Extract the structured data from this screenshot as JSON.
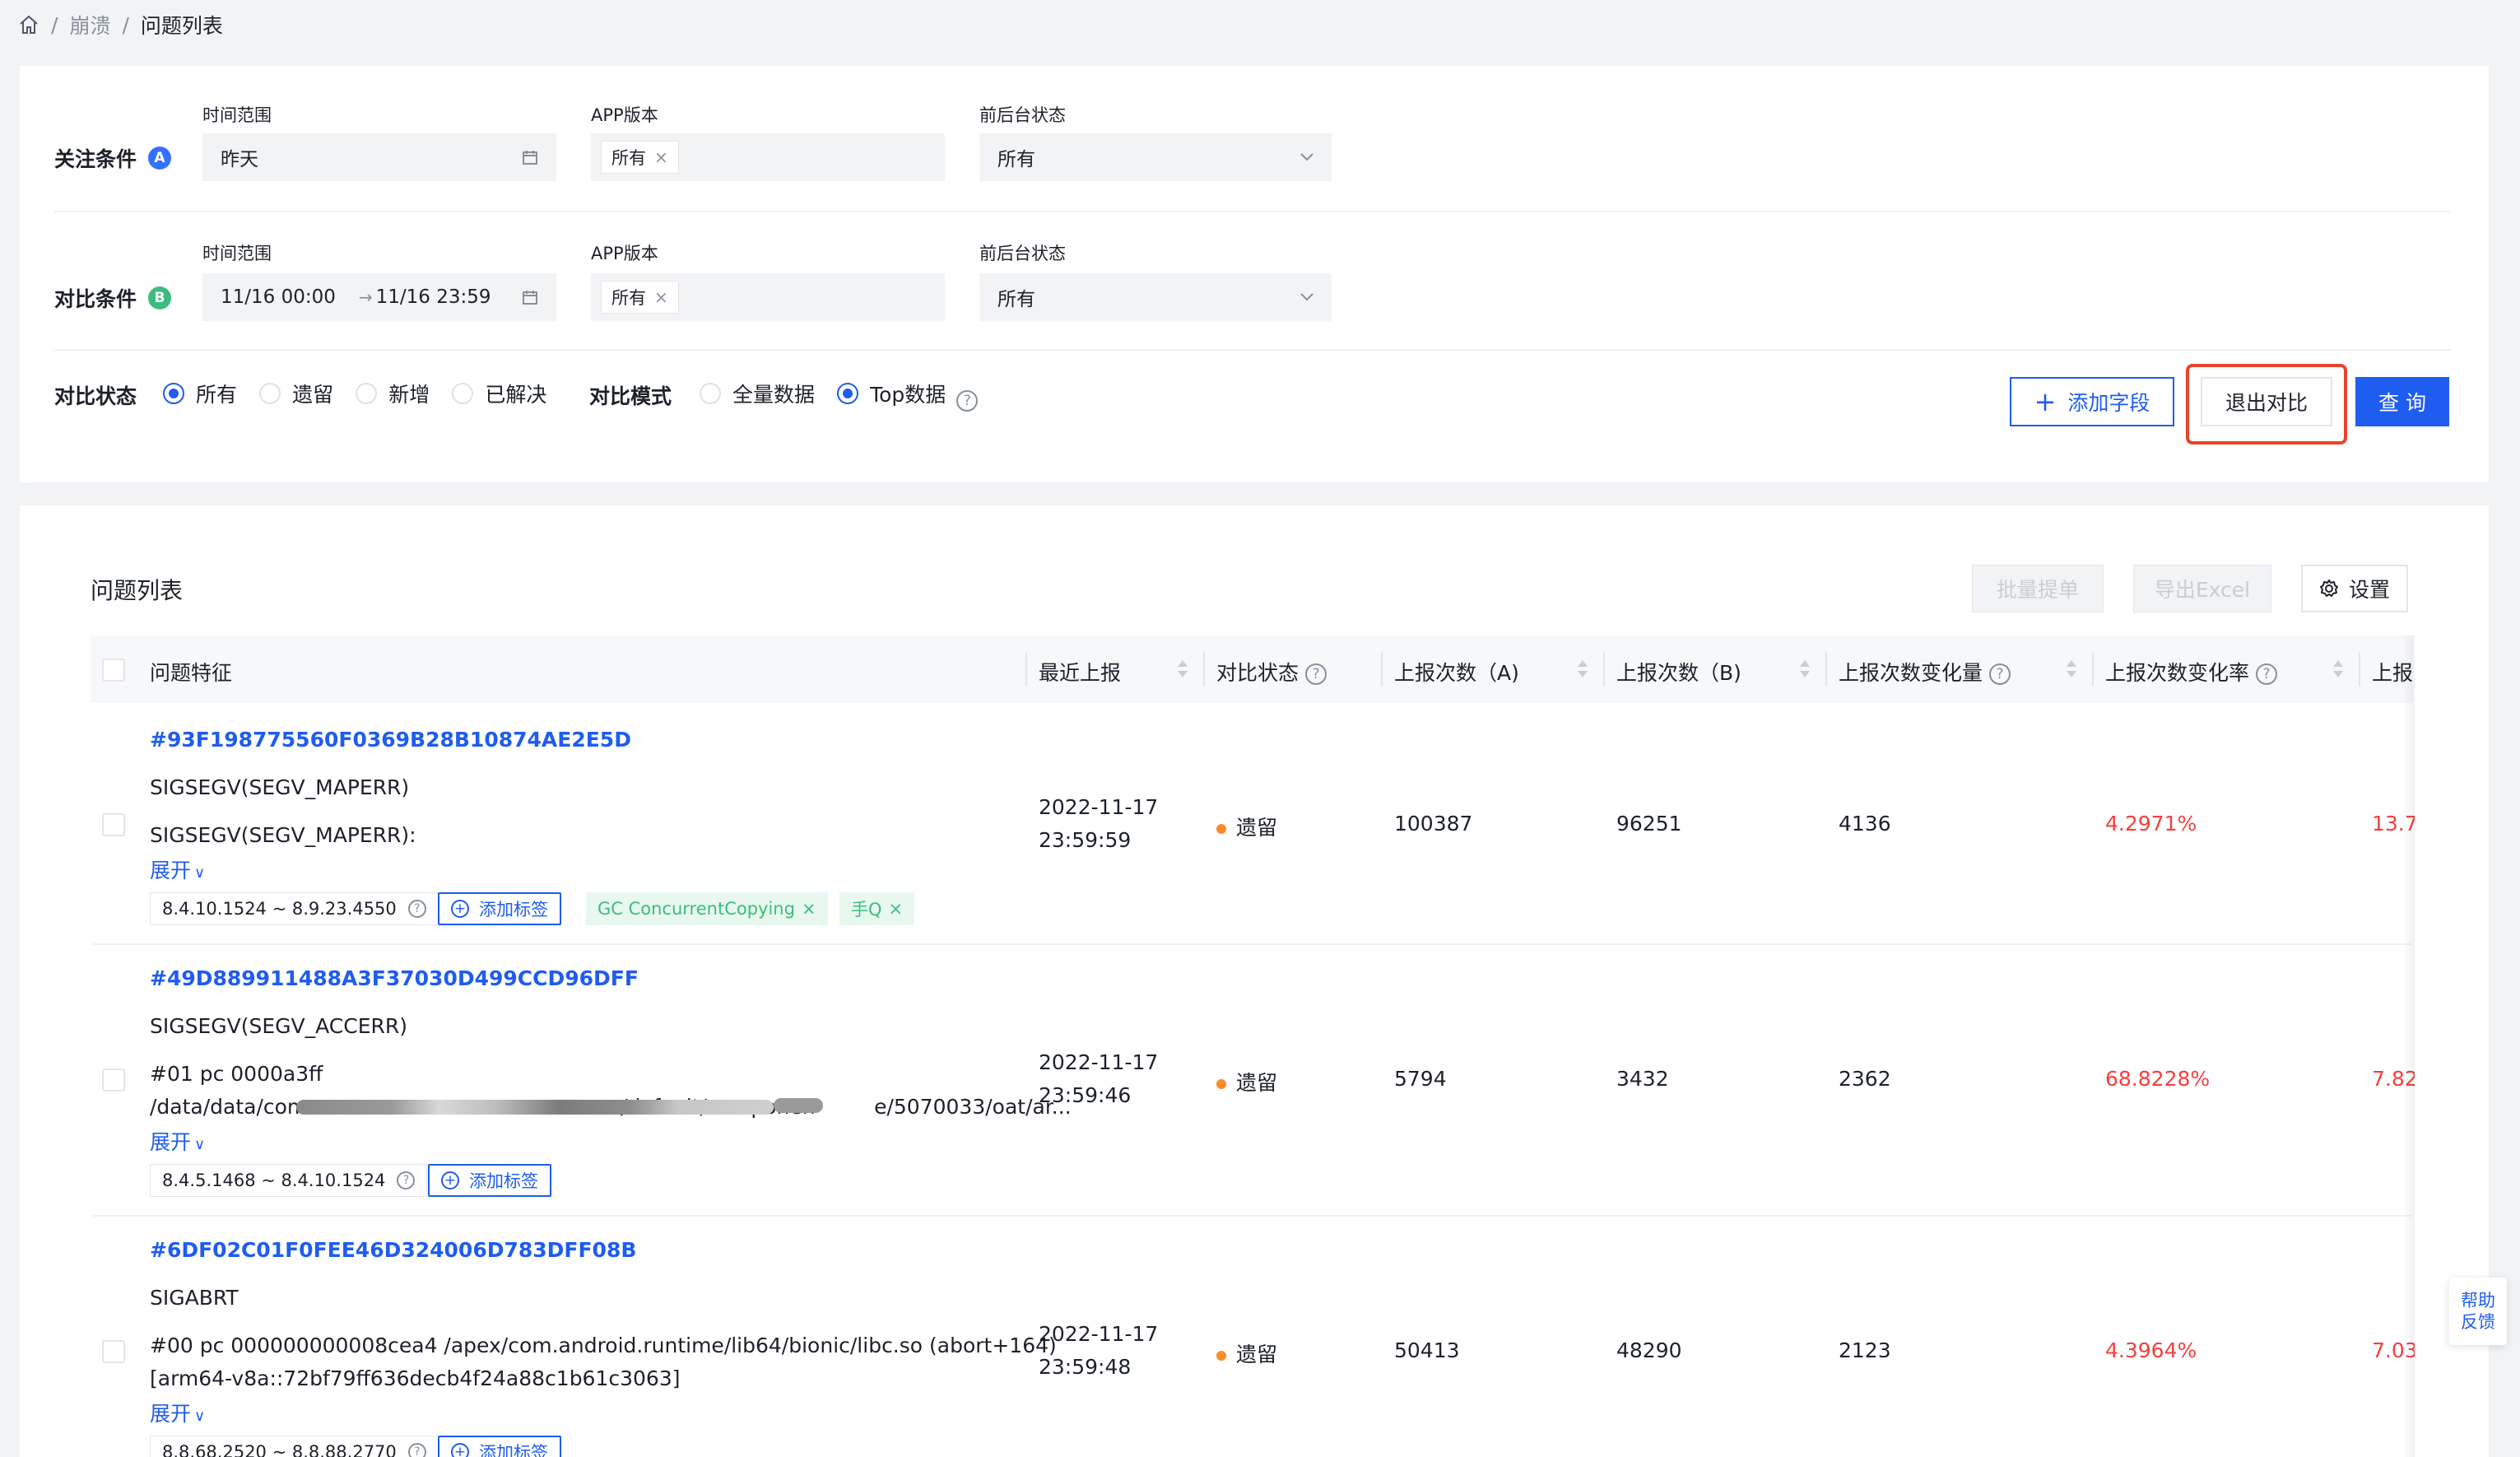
{
  "breadcrumb": {
    "home_icon": "home-icon",
    "level1": "崩溃",
    "current": "问题列表",
    "separator": "/"
  },
  "focus": {
    "title": "关注条件",
    "badge": "A",
    "badge_color": "#3370ff",
    "time_label": "时间范围",
    "time_value": "昨天",
    "app_label": "APP版本",
    "app_chip": "所有",
    "state_label": "前后台状态",
    "state_value": "所有"
  },
  "compare": {
    "title": "对比条件",
    "badge": "B",
    "badge_color": "#3dbd7d",
    "time_label": "时间范围",
    "time_start": "11/16 00:00",
    "time_arrow": "→",
    "time_end": "11/16 23:59",
    "app_label": "APP版本",
    "app_chip": "所有",
    "state_label": "前后台状态",
    "state_value": "所有"
  },
  "status": {
    "label": "对比状态",
    "options": [
      "所有",
      "遗留",
      "新增",
      "已解决"
    ],
    "selected": "所有"
  },
  "mode": {
    "label": "对比模式",
    "options": [
      "全量数据",
      "Top数据"
    ],
    "selected": "Top数据"
  },
  "buttons": {
    "add_field": "添加字段",
    "exit_compare": "退出对比",
    "query": "查 询"
  },
  "list": {
    "title": "问题列表",
    "batch": "批量提单",
    "export": "导出Excel",
    "settings": "设置",
    "columns": [
      "问题特征",
      "最近上报",
      "对比状态",
      "上报次数（A)",
      "上报次数（B)",
      "上报次数变化量",
      "上报次数变化率",
      "上报"
    ],
    "rows": [
      {
        "id": "#93F198775560F0369B28B10874AE2E5D",
        "signal": "SIGSEGV(SEGV_MAPERR)",
        "detail1": "SIGSEGV(SEGV_MAPERR):",
        "detail2": "",
        "expand": "展开",
        "version": "8.4.10.1524 ~ 8.9.23.4550",
        "add_tag": "添加标签",
        "tags": [
          "GC ConcurrentCopying",
          "手Q"
        ],
        "date": "2022-11-17",
        "time": "23:59:59",
        "state": "遗留",
        "a": "100387",
        "b": "96251",
        "delta": "4136",
        "rate": "4.2971%",
        "extra": "13.7"
      },
      {
        "id": "#49D889911488A3F37030D499CCD96DFF",
        "signal": "SIGSEGV(SEGV_ACCERR)",
        "detail1": "#01 pc 0000a3ff",
        "detail2": "/data/data/com                                        .ome/default/componen         e/5070033/oat/ar...",
        "expand": "展开",
        "version": "8.4.5.1468 ~ 8.4.10.1524",
        "add_tag": "添加标签",
        "tags": [],
        "date": "2022-11-17",
        "time": "23:59:46",
        "state": "遗留",
        "a": "5794",
        "b": "3432",
        "delta": "2362",
        "rate": "68.8228%",
        "extra": "7.82"
      },
      {
        "id": "#6DF02C01F0FEE46D324006D783DFF08B",
        "signal": "SIGABRT",
        "detail1": "#00 pc 000000000008cea4 /apex/com.android.runtime/lib64/bionic/libc.so (abort+164)",
        "detail2": "[arm64-v8a::72bf79ff636decb4f24a88c1b61c3063]",
        "expand": "展开",
        "version": "8.8.68.2520 ~ 8.8.88.2770",
        "add_tag": "添加标签",
        "tags": [],
        "date": "2022-11-17",
        "time": "23:59:48",
        "state": "遗留",
        "a": "50413",
        "b": "48290",
        "delta": "2123",
        "rate": "4.3964%",
        "extra": "7.03"
      }
    ]
  },
  "help_float": {
    "line1": "帮助",
    "line2": "反馈"
  },
  "colors": {
    "primary": "#1f5cf0",
    "danger": "#f53f3f",
    "highlight_border": "#e8432c"
  }
}
